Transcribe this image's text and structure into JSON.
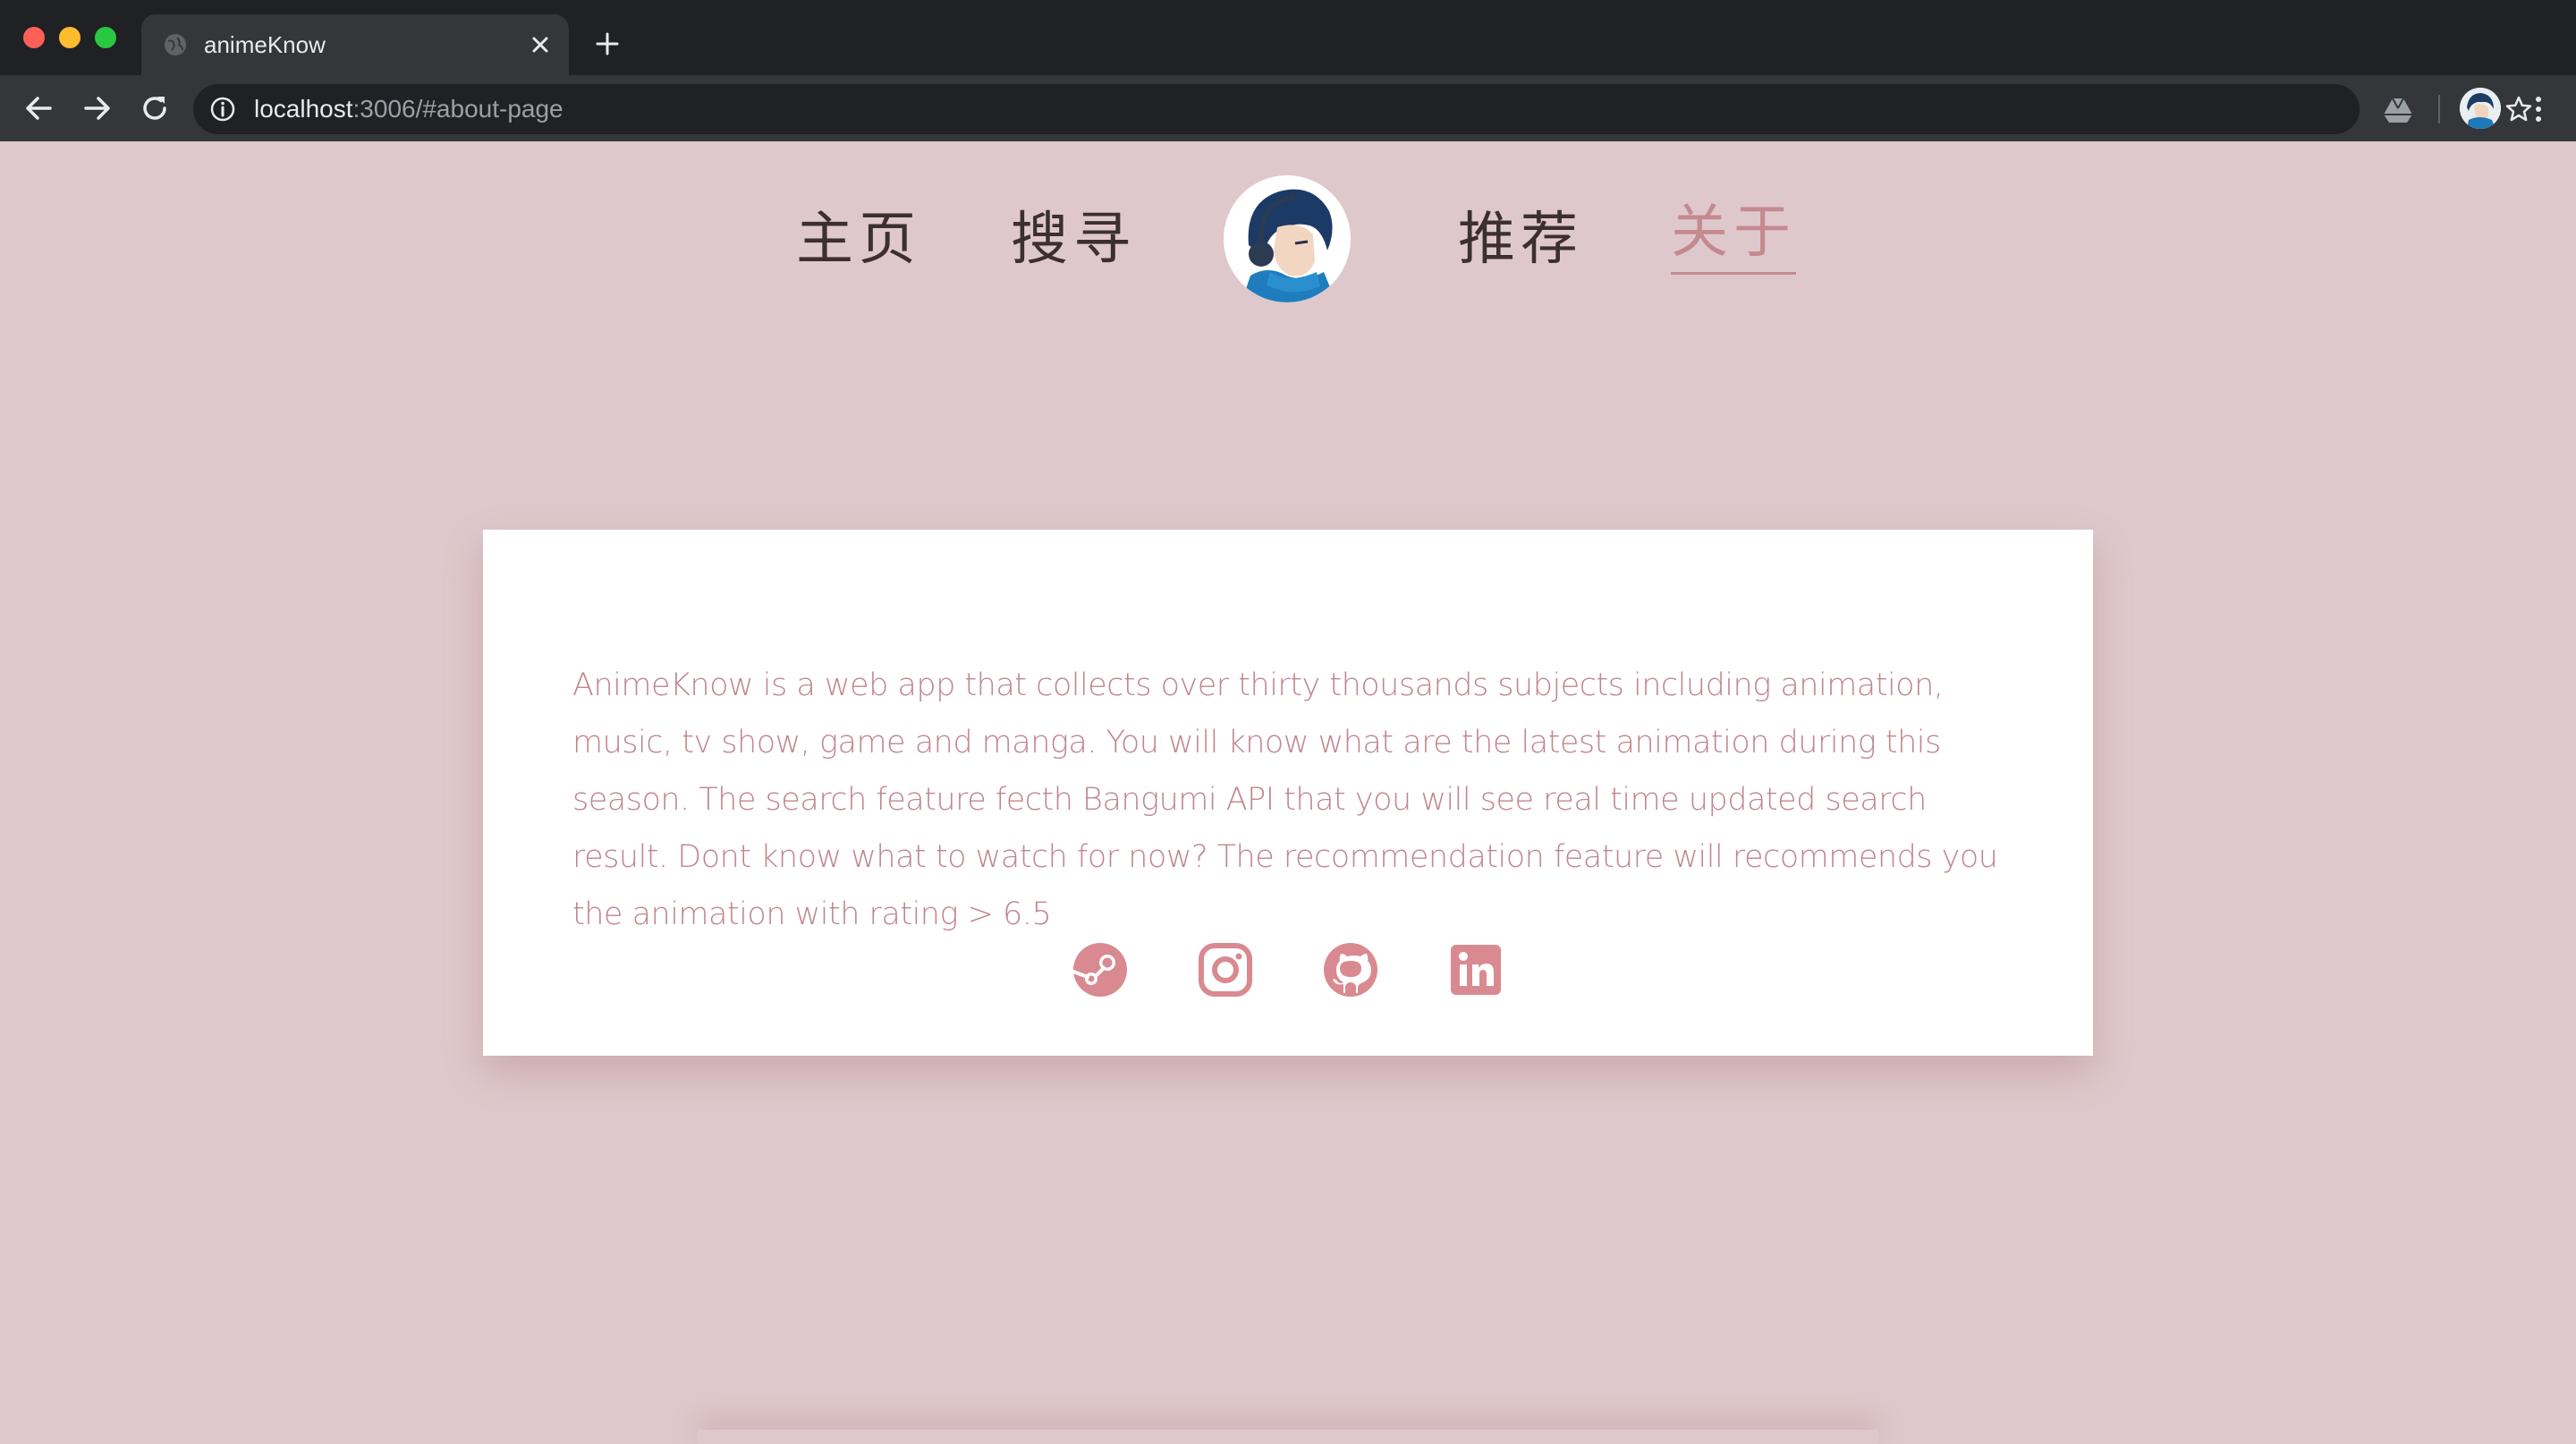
{
  "browser": {
    "tab_title": "animeKnow",
    "url_host": "localhost",
    "url_rest": ":3006/#about-page"
  },
  "nav": {
    "items": [
      {
        "label": "主页",
        "active": false
      },
      {
        "label": "搜寻",
        "active": false
      },
      {
        "label": "推荐",
        "active": false
      },
      {
        "label": "关于",
        "active": true
      }
    ]
  },
  "about": {
    "text": "AnimeKnow is a web app that collects over thirty thousands subjects including animation, music, tv show, game and manga. You will know what are the latest animation during this season. The search feature fecth Bangumi API that you will see real time updated search result. Dont know what to watch for now? The recommendation feature will recommends you the animation with rating > 6.5"
  },
  "social": {
    "icons": [
      "steam-icon",
      "instagram-icon",
      "github-icon",
      "linkedin-icon"
    ],
    "color": "#d98a90"
  },
  "colors": {
    "page_bg": "#dfc8cb",
    "accent": "#c48a90",
    "text_link": "#3b2f31"
  }
}
